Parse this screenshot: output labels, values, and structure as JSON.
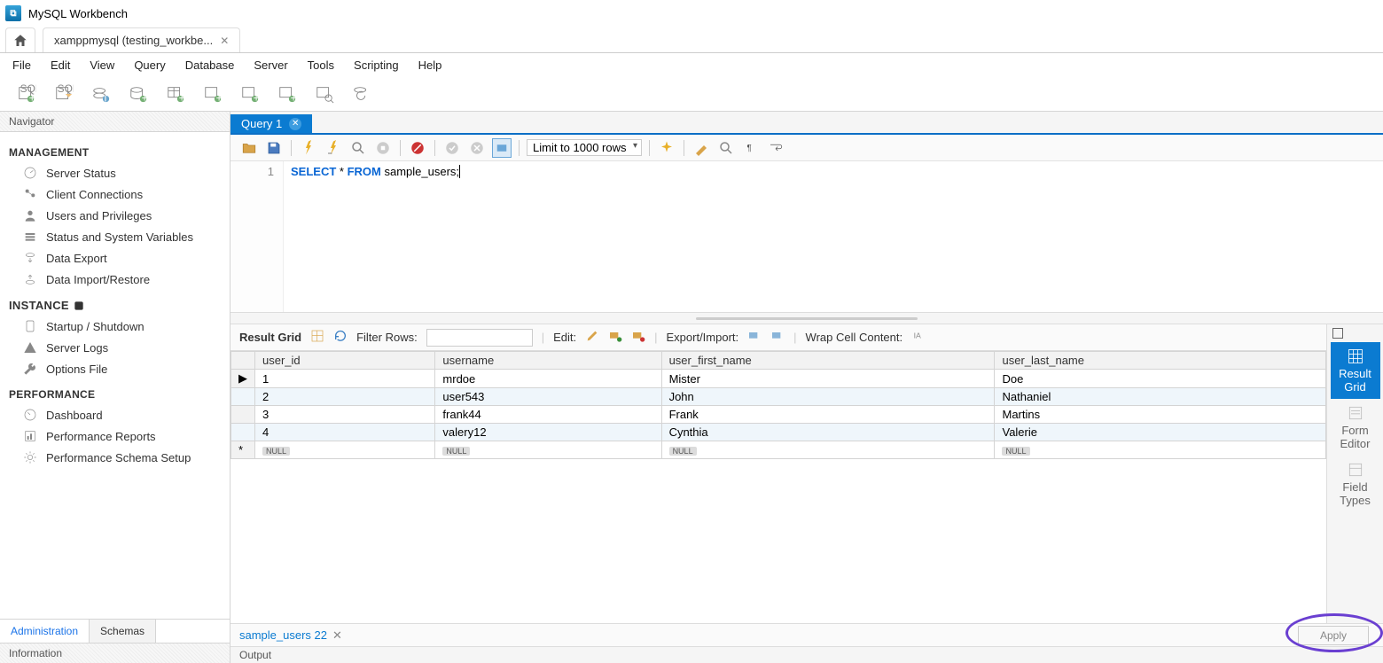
{
  "app": {
    "title": "MySQL Workbench"
  },
  "connection_tab": {
    "label": "xamppmysql (testing_workbe..."
  },
  "menu": [
    "File",
    "Edit",
    "View",
    "Query",
    "Database",
    "Server",
    "Tools",
    "Scripting",
    "Help"
  ],
  "navigator": {
    "header": "Navigator",
    "sections": {
      "management": {
        "title": "MANAGEMENT",
        "items": [
          "Server Status",
          "Client Connections",
          "Users and Privileges",
          "Status and System Variables",
          "Data Export",
          "Data Import/Restore"
        ]
      },
      "instance": {
        "title": "INSTANCE",
        "items": [
          "Startup / Shutdown",
          "Server Logs",
          "Options File"
        ]
      },
      "performance": {
        "title": "PERFORMANCE",
        "items": [
          "Dashboard",
          "Performance Reports",
          "Performance Schema Setup"
        ]
      }
    },
    "tabs": {
      "administration": "Administration",
      "schemas": "Schemas"
    },
    "info": "Information"
  },
  "query_tab": {
    "label": "Query 1"
  },
  "sql_toolbar": {
    "limit_label": "Limit to 1000 rows"
  },
  "editor": {
    "line_no": "1",
    "kw_select": "SELECT",
    "star": " * ",
    "kw_from": "FROM",
    "rest": " sample_users;"
  },
  "result_bar": {
    "title": "Result Grid",
    "filter_label": "Filter Rows:",
    "edit_label": "Edit:",
    "export_label": "Export/Import:",
    "wrap_label": "Wrap Cell Content:"
  },
  "grid": {
    "columns": [
      "user_id",
      "username",
      "user_first_name",
      "user_last_name"
    ],
    "rows": [
      [
        "1",
        "mrdoe",
        "Mister",
        "Doe"
      ],
      [
        "2",
        "user543",
        "John",
        "Nathaniel"
      ],
      [
        "3",
        "frank44",
        "Frank",
        "Martins"
      ],
      [
        "4",
        "valery12",
        "Cynthia",
        "Valerie"
      ]
    ],
    "null_label": "NULL"
  },
  "side_tabs": {
    "result_grid": "Result\nGrid",
    "form_editor": "Form\nEditor",
    "field_types": "Field\nTypes"
  },
  "bottom_tab": {
    "label": "sample_users 22"
  },
  "apply": {
    "label": "Apply"
  },
  "output": {
    "label": "Output"
  }
}
